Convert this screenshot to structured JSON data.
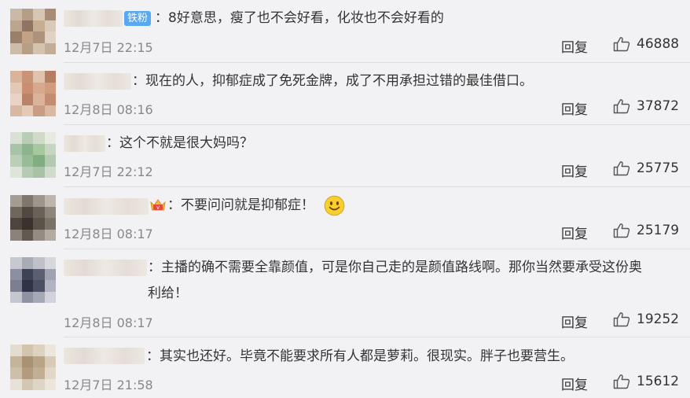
{
  "comments": [
    {
      "text": "：8好意思，瘦了也不会好看，化妆也不会好看的",
      "badge": "铁粉",
      "time": "12月7日 22:15",
      "reply": "回复",
      "likes": "46888",
      "avatar_colors": [
        "#c9b9a6",
        "#b59e86",
        "#d6c6b3",
        "#a98c74",
        "#bda48c",
        "#8f7461",
        "#c7ad92",
        "#d8c9b9",
        "#9a7f69",
        "#c1a286",
        "#ae937c",
        "#e0d3c4",
        "#cdbca9",
        "#b89e84",
        "#d4c3b1",
        "#c2ad98"
      ]
    },
    {
      "text": "：现在的人，抑郁症成了免死金牌，成了不用承担过错的最佳借口。",
      "time": "12月8日 08:16",
      "reply": "回复",
      "likes": "37872",
      "avatar_colors": [
        "#d9b39a",
        "#c89377",
        "#e1c2ad",
        "#b57e63",
        "#e3c8b6",
        "#c98f73",
        "#d8a88c",
        "#cf9c80",
        "#e8d3c4",
        "#b98369",
        "#dcb29a",
        "#c48c71",
        "#d7b8a3",
        "#e4c9b7",
        "#c99c84",
        "#dbb8a1"
      ]
    },
    {
      "text": "：这个不就是很大妈吗？",
      "time": "12月7日 22:12",
      "reply": "回复",
      "likes": "25775",
      "avatar_colors": [
        "#d9e1d5",
        "#b8cdb4",
        "#cfdac9",
        "#e6ebe2",
        "#a7c4a6",
        "#8db38f",
        "#a6c8a0",
        "#c6d6c2",
        "#b9d0b6",
        "#98bd96",
        "#7fae82",
        "#b3c9b0",
        "#dde5d9",
        "#b6cbb3",
        "#a8c2a6",
        "#cfdccb"
      ]
    },
    {
      "text": "：不要问问就是抑郁症！",
      "time": "12月8日 08:17",
      "reply": "回复",
      "likes": "25179",
      "avatar_colors": [
        "#a49d94",
        "#7f776d",
        "#9d968c",
        "#bcb6ae",
        "#6f665c",
        "#524a42",
        "#6a6158",
        "#8d857b",
        "#4e463e",
        "#3a332d",
        "#5b5249",
        "#7a7167",
        "#8b8379",
        "#625950",
        "#948c82",
        "#b2aba2"
      ]
    },
    {
      "text": "：主播的确不需要全靠颜值，可是你自己走的是颜值路线啊。那你当然要承受这份奥\n利给！",
      "time": "12月8日 08:17",
      "reply": "回复",
      "likes": "19252",
      "avatar_colors": [
        "#c8c9d0",
        "#a9abb6",
        "#bfc0c8",
        "#d7d8de",
        "#8c8fa0",
        "#3d4254",
        "#5a5f72",
        "#9fa2b0",
        "#7b7f91",
        "#2f3345",
        "#4b5064",
        "#b1b4c0",
        "#c5c7cf",
        "#8e92a3",
        "#a5a8b5",
        "#d2d3da"
      ]
    },
    {
      "text": "：其实也还好。毕竟不能要求所有人都是萝莉。很现实。胖子也要营生。",
      "time": "12月7日 21:58",
      "reply": "回复",
      "likes": "15612",
      "avatar_colors": [
        "#e4dccf",
        "#d2c4ad",
        "#ddd2c0",
        "#ece6dc",
        "#c5b498",
        "#a99174",
        "#b9a486",
        "#d7cbb8",
        "#cdbfa8",
        "#b39c7e",
        "#c2ae92",
        "#e1d8ca",
        "#e8e1d6",
        "#d4c7b2",
        "#dfd5c5",
        "#ebe5da"
      ]
    }
  ],
  "icons": {
    "like": "thumbs-up-icon",
    "crown": "crown-badge-icon",
    "emoji": "smiley-emoji-icon"
  }
}
